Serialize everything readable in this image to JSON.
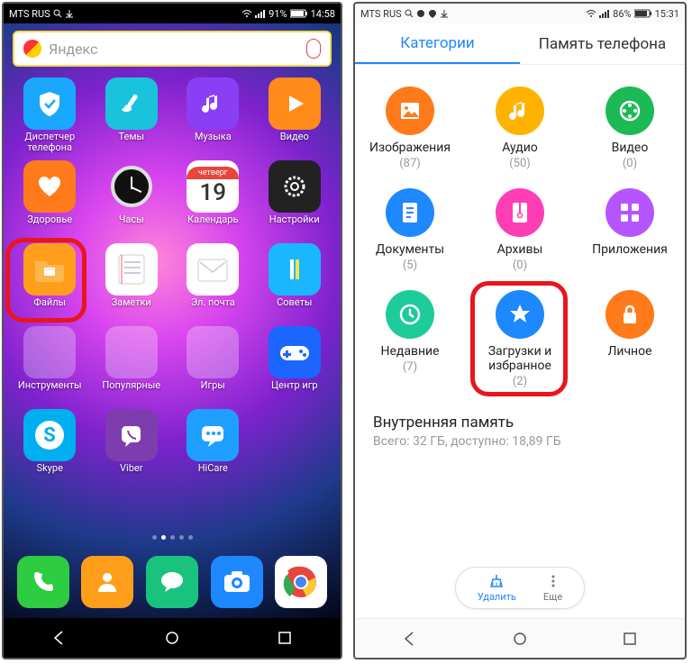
{
  "left": {
    "status": {
      "carrier": "MTS RUS",
      "battery": "91%",
      "time": "14:58"
    },
    "search": {
      "placeholder": "Яндекс"
    },
    "apps": [
      {
        "label": "Диспетчер телефона",
        "bg": "#1aa8ff",
        "glyph": "shield"
      },
      {
        "label": "Темы",
        "bg": "#19c3dd",
        "glyph": "brush"
      },
      {
        "label": "Музыка",
        "bg": "#8a3ff5",
        "glyph": "music"
      },
      {
        "label": "Видео",
        "bg": "#ff8b1a",
        "glyph": "play"
      },
      {
        "label": "Здоровье",
        "bg": "#ff7a1a",
        "glyph": "heart"
      },
      {
        "label": "Часы",
        "bg": "#000",
        "glyph": "clock"
      },
      {
        "label": "Календарь",
        "bg": "#fff",
        "glyph": "calendar",
        "day": "четверг",
        "date": "19"
      },
      {
        "label": "Настройки",
        "bg": "#222",
        "glyph": "gear"
      },
      {
        "label": "Файлы",
        "bg": "#ff9e1a",
        "glyph": "folder",
        "highlight": true
      },
      {
        "label": "Заметки",
        "bg": "#fff",
        "glyph": "notes"
      },
      {
        "label": "Эл. почта",
        "bg": "#fff",
        "glyph": "mail"
      },
      {
        "label": "Советы",
        "bg": "#1ab7ff",
        "glyph": "info"
      },
      {
        "label": "Инструменты",
        "bg": "folder",
        "glyph": "folder-multi"
      },
      {
        "label": "Популярные",
        "bg": "folder",
        "glyph": "folder-multi"
      },
      {
        "label": "Игры",
        "bg": "folder",
        "glyph": "folder-multi"
      },
      {
        "label": "Центр игр",
        "bg": "#1a66ff",
        "glyph": "gamepad"
      },
      {
        "label": "Skype",
        "bg": "#00aff0",
        "glyph": "skype"
      },
      {
        "label": "Viber",
        "bg": "#7d3daf",
        "glyph": "viber"
      },
      {
        "label": "HiCare",
        "bg": "#1e9fff",
        "glyph": "chat"
      }
    ],
    "dock": [
      {
        "bg": "#2ecc40",
        "glyph": "phone",
        "name": "phone"
      },
      {
        "bg": "#ff9e1a",
        "glyph": "contacts",
        "name": "contacts"
      },
      {
        "bg": "#19c37d",
        "glyph": "sms",
        "name": "messages"
      },
      {
        "bg": "#1e88ff",
        "glyph": "camera",
        "name": "camera"
      },
      {
        "bg": "#fff",
        "glyph": "chrome",
        "name": "chrome"
      }
    ]
  },
  "right": {
    "status": {
      "carrier": "MTS RUS",
      "battery": "86%",
      "time": "15:31"
    },
    "tabs": {
      "active": "Категории",
      "other": "Память телефона"
    },
    "categories": [
      {
        "label": "Изображения",
        "count": "(87)",
        "color": "#ff7a1a",
        "glyph": "image"
      },
      {
        "label": "Аудио",
        "count": "(50)",
        "color": "#ffb300",
        "glyph": "music"
      },
      {
        "label": "Видео",
        "count": "(0)",
        "color": "#1db954",
        "glyph": "film"
      },
      {
        "label": "Документы",
        "count": "(5)",
        "color": "#1e88ff",
        "glyph": "doc"
      },
      {
        "label": "Архивы",
        "count": "(0)",
        "color": "#ff3db5",
        "glyph": "zip"
      },
      {
        "label": "Приложения",
        "count": "",
        "color": "#b455ff",
        "glyph": "apps"
      },
      {
        "label": "Недавние",
        "count": "(7)",
        "color": "#1ecb9a",
        "glyph": "recent"
      },
      {
        "label": "Загрузки и избранное",
        "count": "(2)",
        "color": "#1e88ff",
        "glyph": "star",
        "highlight": true
      },
      {
        "label": "Личное",
        "count": "",
        "color": "#ff7a1a",
        "glyph": "lock"
      }
    ],
    "storage": {
      "title": "Внутренняя память",
      "detail": "Всего: 32 ГБ, доступно: 18,89 ГБ"
    },
    "bottom": {
      "delete": "Удалить",
      "more": "Еще"
    }
  }
}
